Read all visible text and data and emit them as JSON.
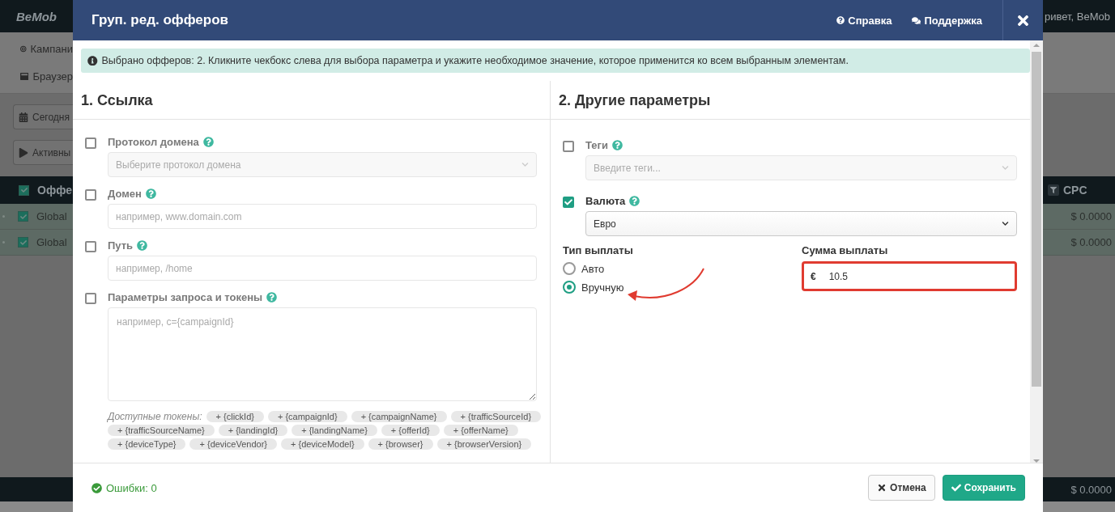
{
  "background_page": {
    "logo": "BeMob",
    "user_greeting": "ривет, BeMob",
    "menu": [
      "Кампани",
      "Браузер"
    ],
    "filters": [
      "Сегодня",
      "Активны"
    ],
    "table": {
      "columns": [
        {
          "label": "Оффе",
          "checked": true
        },
        {
          "label": "CPC"
        }
      ],
      "rows": [
        {
          "name": "Global",
          "cpc": "$ 0.0000",
          "checked": true
        },
        {
          "name": "Global",
          "cpc": "$ 0.0000",
          "checked": true
        }
      ],
      "total_cpc": "$ 0.0000"
    }
  },
  "dialog": {
    "title": "Груп. ред. офферов",
    "header_links": [
      {
        "label": "Справка",
        "kind": "help"
      },
      {
        "label": "Поддержка",
        "kind": "support"
      }
    ],
    "info": "Выбрано офферов: 2. Кликните чекбокс слева для выбора параметра и укажите необходимое значение, которое применится ко всем выбранным элементам.",
    "sections": [
      {
        "title": "1. Ссылка",
        "fields": [
          {
            "kind": "select",
            "label": "Протокол домена",
            "checked": false,
            "placeholder": "Выберите протокол домена"
          },
          {
            "kind": "input",
            "label": "Домен",
            "checked": false,
            "placeholder": "например, www.domain.com"
          },
          {
            "kind": "input",
            "label": "Путь",
            "checked": false,
            "placeholder": "например, /home"
          },
          {
            "kind": "textarea",
            "label": "Параметры запроса и токены",
            "checked": false,
            "placeholder": "например, c={campaignId}"
          }
        ],
        "tokens": {
          "label": "Доступные токены:",
          "items": [
            "+ {clickId}",
            "+ {campaignId}",
            "+ {campaignName}",
            "+ {trafficSourceId}",
            "+ {trafficSourceName}",
            "+ {landingId}",
            "+ {landingName}",
            "+ {offerId}",
            "+ {offerName}",
            "+ {deviceType}",
            "+ {deviceVendor}",
            "+ {deviceModel}",
            "+ {browser}",
            "+ {browserVersion}"
          ]
        }
      },
      {
        "title": "2. Другие параметры",
        "fields": [
          {
            "kind": "select",
            "label": "Теги",
            "checked": false,
            "placeholder": "Введите теги..."
          },
          {
            "kind": "select",
            "label": "Валюта",
            "checked": true,
            "value": "Евро"
          },
          {
            "kind": "payout",
            "type_label": "Тип выплаты",
            "options": [
              {
                "label": "Авто",
                "selected": false
              },
              {
                "label": "Вручную",
                "selected": true
              }
            ],
            "amount_label": "Сумма выплаты",
            "currency_symbol": "€",
            "amount": "10.5",
            "highlighted": true
          }
        ]
      }
    ],
    "errors": "Ошибки: 0",
    "buttons": [
      {
        "label": "Отмена",
        "kind": "cancel"
      },
      {
        "label": "Сохранить",
        "kind": "save"
      }
    ]
  }
}
